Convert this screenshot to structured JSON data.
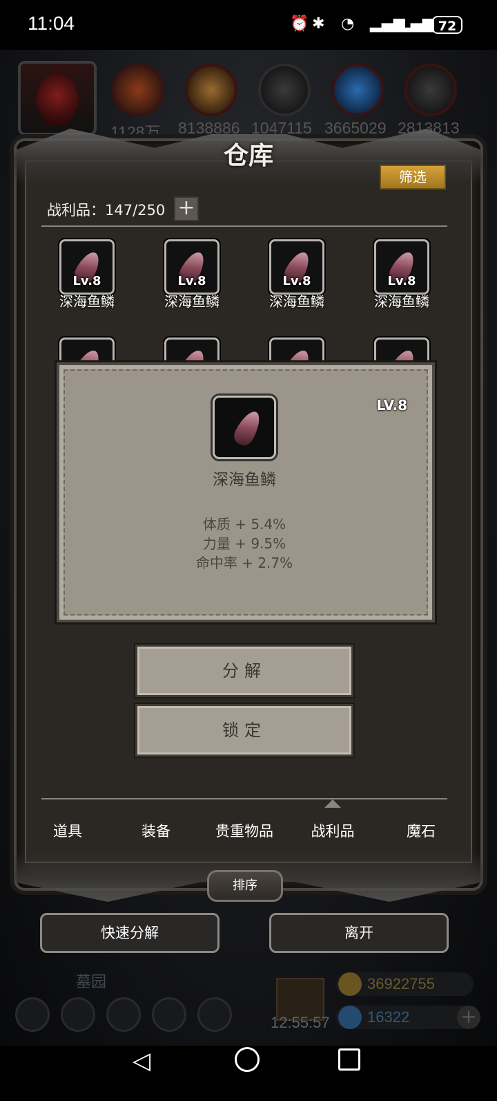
{
  "status_bar": {
    "time": "11:04",
    "battery": "72"
  },
  "resources": {
    "values": [
      "1128万",
      "8138886",
      "1047115",
      "3665029",
      "2813813"
    ]
  },
  "warehouse": {
    "title": "仓库",
    "filter_label": "筛选",
    "loot_count": "战利品：147/250",
    "add_label": "+",
    "items": [
      {
        "level": "Lv.8",
        "name": "深海鱼鳞"
      },
      {
        "level": "Lv.8",
        "name": "深海鱼鳞"
      },
      {
        "level": "Lv.8",
        "name": "深海鱼鳞"
      },
      {
        "level": "Lv.8",
        "name": "深海鱼鳞"
      }
    ]
  },
  "tooltip": {
    "level": "LV.8",
    "name": "深海鱼鳞",
    "stats": [
      "体质 + 5.4%",
      "力量 + 9.5%",
      "命中率 + 2.7%"
    ]
  },
  "actions": {
    "decompose": "分解",
    "lock": "锁定"
  },
  "tabs": [
    {
      "label": "道具",
      "active": false
    },
    {
      "label": "装备",
      "active": false
    },
    {
      "label": "贵重物品",
      "active": false
    },
    {
      "label": "战利品",
      "active": true
    },
    {
      "label": "魔石",
      "active": false
    }
  ],
  "sort_label": "排序",
  "bottom_buttons": {
    "quick_decompose": "快速分解",
    "leave": "离开"
  },
  "background_hud": {
    "location": "墓园",
    "timer": "12:55:57",
    "gold": "36922755",
    "gems": "16322"
  },
  "colors": {
    "accent_gold": "#c8952f",
    "panel_bg": "#2b2723",
    "tooltip_bg": "#9c958a"
  }
}
